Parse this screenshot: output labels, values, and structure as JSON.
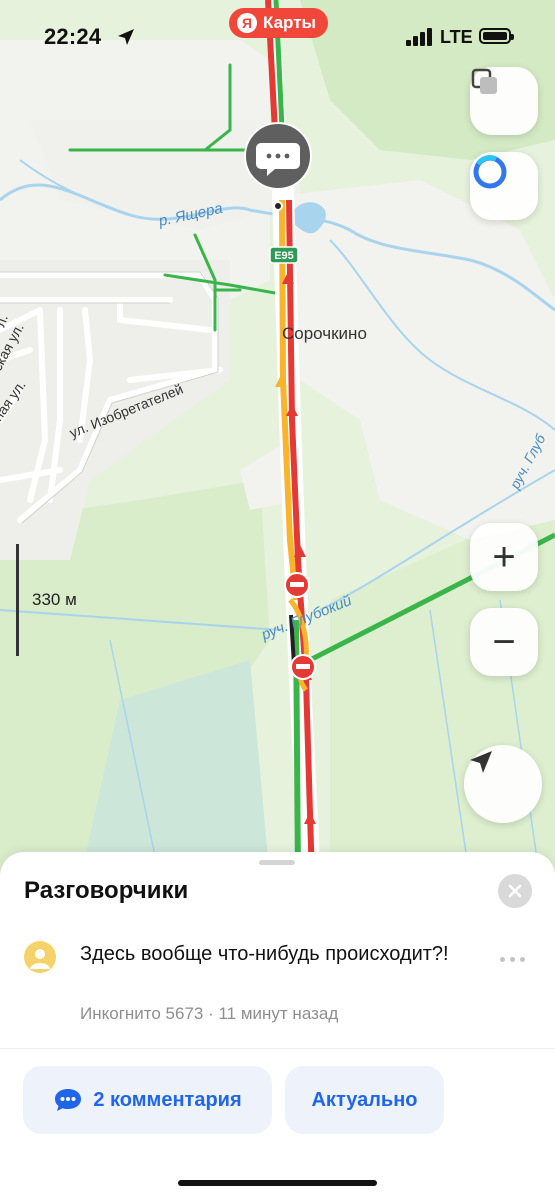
{
  "status_bar": {
    "time": "22:24",
    "app_brand": "Карты",
    "brand_letter": "Я",
    "network": "LTE",
    "icons": [
      "location-arrow-icon",
      "signal-icon",
      "battery-icon"
    ]
  },
  "map": {
    "labels": {
      "river_yashchera": "р. Ящера",
      "highway_badge": "E95",
      "village": "Сорочкино",
      "street_izobretateley": "ул. Изобретателей",
      "street_partial_1": "ская ул.",
      "street_partial_2": "ная ул.",
      "street_partial_3": "л.",
      "brook_glubokiy": "руч. Глубокий",
      "brook_glub_right": "руч. Глуб"
    },
    "scale_text": "330 м",
    "controls": {
      "layers": "layers-icon",
      "assistant": "alice-assistant-icon",
      "zoom_in": "+",
      "zoom_out": "−",
      "locate": "navigation-arrow-icon"
    },
    "colors": {
      "traffic_jam": "#e53935",
      "traffic_slow": "#f7b42c",
      "traffic_free": "#3ab54a",
      "water": "#a8d4ee",
      "forest": "#d6ecc8",
      "settlement": "#f2f2ef"
    }
  },
  "sheet": {
    "title": "Разговорчики",
    "post": {
      "text": "Здесь вообще что-нибудь происходит?!",
      "meta": "Инкогнито 5673 · 11 минут назад"
    },
    "actions": {
      "comments": "2 комментария",
      "relevant": "Актуально"
    }
  }
}
